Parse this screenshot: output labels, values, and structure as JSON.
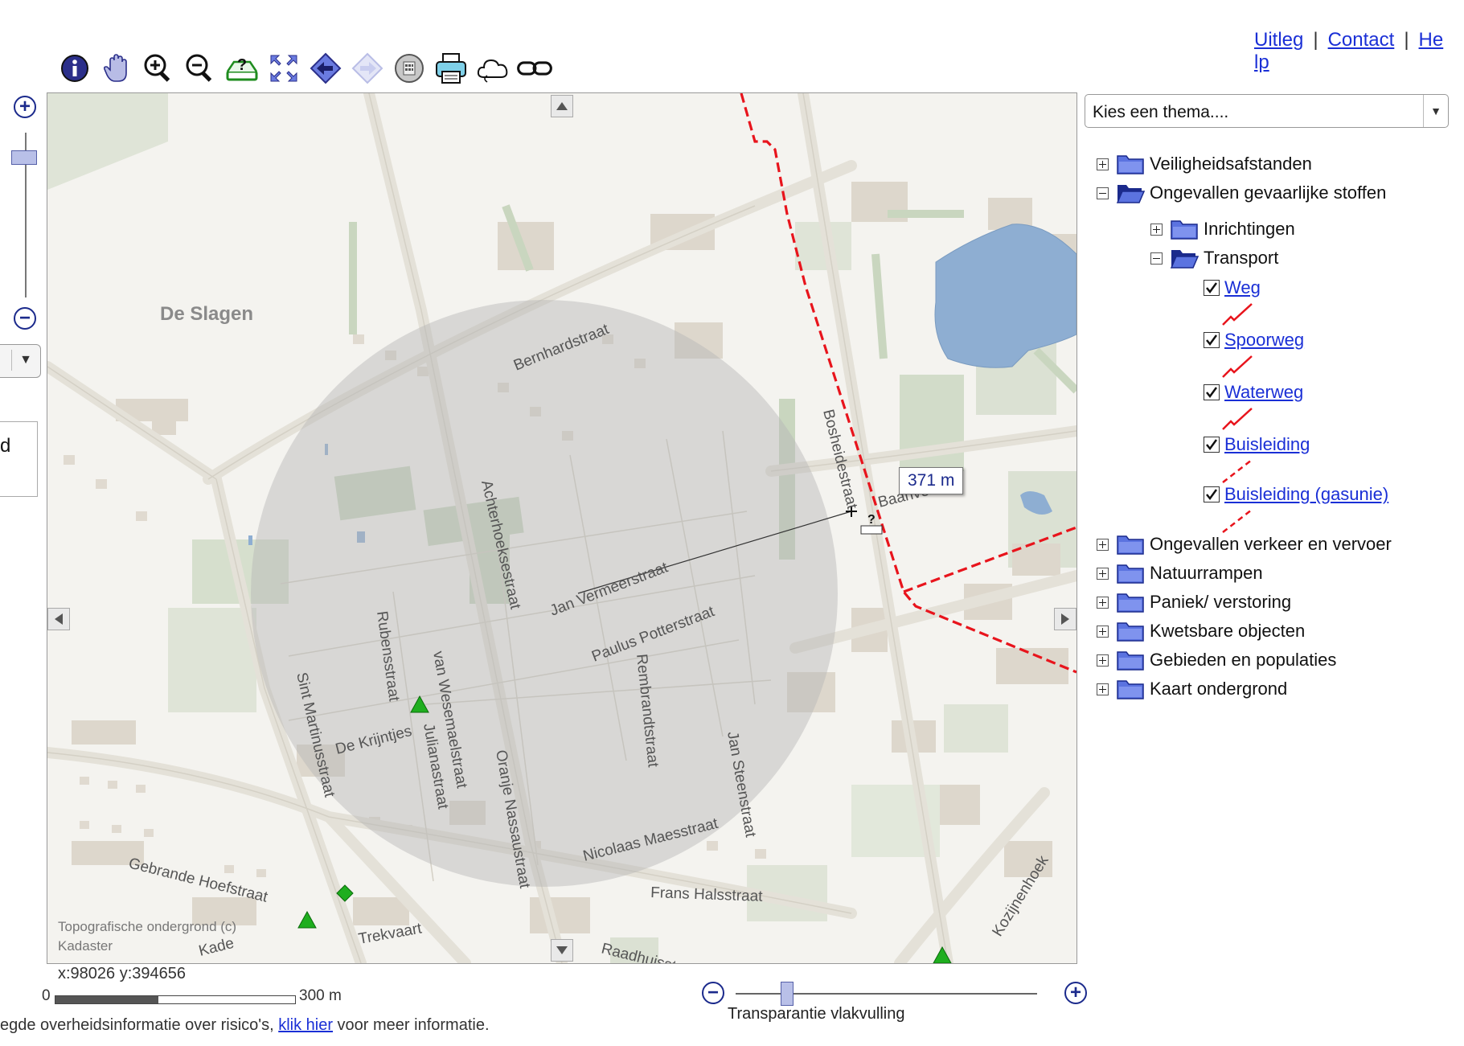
{
  "toolbar": {
    "tools": [
      {
        "name": "info-icon",
        "title": "Info"
      },
      {
        "name": "pan-hand-icon",
        "title": "Pan"
      },
      {
        "name": "zoom-in-icon",
        "title": "Zoom in"
      },
      {
        "name": "zoom-out-icon",
        "title": "Zoom out"
      },
      {
        "name": "identify-icon",
        "title": "Identify"
      },
      {
        "name": "full-extent-icon",
        "title": "Full extent"
      },
      {
        "name": "back-arrow-icon",
        "title": "Back"
      },
      {
        "name": "forward-arrow-icon",
        "title": "Forward"
      },
      {
        "name": "calculator-icon",
        "title": "Calculator"
      },
      {
        "name": "print-icon",
        "title": "Print"
      },
      {
        "name": "cloud-icon",
        "title": "Cloud"
      },
      {
        "name": "link-icon",
        "title": "Link"
      }
    ]
  },
  "top_links": {
    "uitleg": "Uitleg",
    "contact": "Contact",
    "help_line1": "He",
    "help_line2": "lp",
    "separator": "|"
  },
  "left": {
    "zoom_in": "+",
    "zoom_out": "−",
    "panel_fragment": "d"
  },
  "map": {
    "place_labels": {
      "de_slagen": "De Slagen"
    },
    "streets": {
      "bernhardstraat": "Bernhardstraat",
      "achterhoeksestraat": "Achterhoeksestraat",
      "jan_vermeerstraat": "Jan Vermeerstraat",
      "paulus_potterstraat": "Paulus Potterstraat",
      "rubensstraat": "Rubensstraat",
      "sint_martinusstraat": "Sint Martinusstraat",
      "de_krijntjes": "De Krijntjes",
      "julianastraat": "Julianastraat",
      "van_wesemaelstraat": "van Wesemaelstraat",
      "oranje_nassaustraat": "Oranje Nassaustraat",
      "rembrandtstraat": "Rembrandtstraat",
      "jan_steenstraat": "Jan Steenstraat",
      "nicolaas_maesstraat": "Nicolaas Maesstraat",
      "frans_halsstraat": "Frans Halsstraat",
      "gebrande_hoefstraat": "Gebrande Hoefstraat",
      "raadhuisstraat": "Raadhuisstraat",
      "trekvaart": "Trekvaart",
      "kade": "Kade",
      "kozijnenhoek": "Kozijnenhoek",
      "baanvelden": "Baanvelden",
      "bosheidestraat": "Bosheidestraat"
    },
    "measurement": "371 m",
    "copyright_line1": "Topografische ondergrond (c)",
    "copyright_line2": "Kadaster"
  },
  "status": {
    "coordinates": "x:98026 y:394656",
    "scale_start": "0",
    "scale_end": "300 m",
    "scale_fill_fraction": 0.43
  },
  "footer": {
    "text_before": "egde overheidsinformatie over risico's, ",
    "link": "klik hier",
    "text_after": " voor meer informatie."
  },
  "transparency": {
    "label": "Transparantie vlakvulling",
    "minus": "−",
    "plus": "+",
    "value_fraction": 0.17
  },
  "theme_select": {
    "selected": "Kies een thema...."
  },
  "layer_tree": {
    "veiligheidsafstanden": "Veiligheidsafstanden",
    "ongevallen_gevaarlijke_stoffen": "Ongevallen gevaarlijke stoffen",
    "inrichtingen": "Inrichtingen",
    "transport": "Transport",
    "weg": "Weg",
    "spoorweg": "Spoorweg",
    "waterweg": "Waterweg",
    "buisleiding": "Buisleiding",
    "buisleiding_gasunie": "Buisleiding (gasunie)",
    "ongevallen_verkeer": "Ongevallen verkeer en vervoer",
    "natuurrampen": "Natuurrampen",
    "paniek": "Paniek/ verstoring",
    "kwetsbare_objecten": "Kwetsbare objecten",
    "gebieden": "Gebieden en populaties",
    "kaart_ondergrond": "Kaart ondergrond"
  },
  "colors": {
    "link": "#1a2fd6",
    "pipeline": "#e8141c",
    "circle": "#c9c9c9",
    "water": "#8eaed2",
    "green": "#c9d6bf",
    "folder": "#5b73e0",
    "marker": "#1fae1f"
  }
}
